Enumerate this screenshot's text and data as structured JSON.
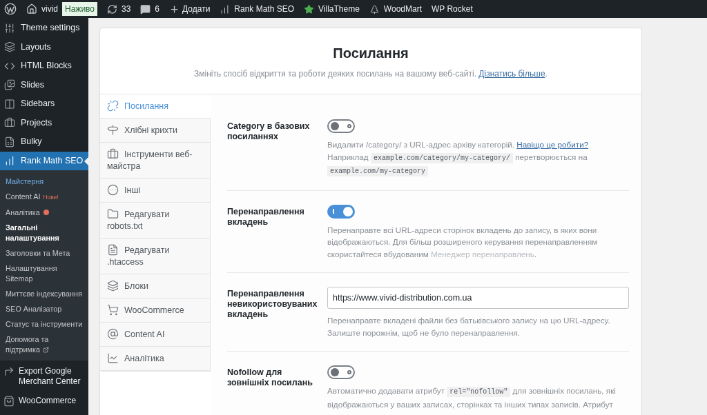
{
  "admin_bar": {
    "site": "vivid",
    "live_badge": "Наживо",
    "updates": "33",
    "comments": "6",
    "new": "Додати",
    "links": [
      "Rank Math SEO",
      "VillaTheme",
      "WoodMart",
      "WP Rocket"
    ]
  },
  "sidebar": {
    "items": [
      {
        "label": "Theme settings",
        "selected": false
      },
      {
        "label": "Layouts",
        "selected": false
      },
      {
        "label": "HTML Blocks",
        "selected": false
      },
      {
        "label": "Slides",
        "selected": false
      },
      {
        "label": "Sidebars",
        "selected": false
      },
      {
        "label": "Projects",
        "selected": false
      },
      {
        "label": "Bulky",
        "selected": false
      },
      {
        "label": "Rank Math SEO",
        "selected": true
      }
    ],
    "submenu": [
      {
        "label": "Майстерня",
        "kind": "plain",
        "selected": false,
        "highlighted": true
      },
      {
        "label": "Content AI",
        "kind": "badge",
        "badge": "Нове!",
        "selected": false,
        "highlighted": false
      },
      {
        "label": "Аналітика",
        "kind": "dot",
        "selected": false,
        "highlighted": false
      },
      {
        "label": "Загальні налаштування",
        "kind": "plain",
        "selected": true,
        "highlighted": false
      },
      {
        "label": "Заголовки та Мета",
        "kind": "plain",
        "selected": false,
        "highlighted": false
      },
      {
        "label": "Налаштування Sitemap",
        "kind": "plain",
        "selected": false,
        "highlighted": false
      },
      {
        "label": "Миттєве індексування",
        "kind": "plain",
        "selected": false,
        "highlighted": false
      },
      {
        "label": "SEO Аналізатор",
        "kind": "plain",
        "selected": false,
        "highlighted": false
      },
      {
        "label": "Статус та інструменти",
        "kind": "plain",
        "selected": false,
        "highlighted": false
      },
      {
        "label": "Допомога та підтримка",
        "kind": "external",
        "selected": false,
        "highlighted": false
      }
    ],
    "after": [
      "Export Google Merchant Center",
      "WooCommerce"
    ]
  },
  "header": {
    "title": "Посилання",
    "subtitle": "Змініть спосіб відкриття та роботи деяких посилань на вашому веб-сайті.",
    "link": "Дізнатись більше",
    "end": "."
  },
  "tabs": [
    {
      "label": "Посилання",
      "selected": true
    },
    {
      "label": "Хлібні крихти",
      "selected": false
    },
    {
      "label": "Інструменти веб-майстра",
      "selected": false
    },
    {
      "label": "Інші",
      "selected": false
    },
    {
      "label": "Редагувати robots.txt",
      "selected": false
    },
    {
      "label": "Редагувати .htaccess",
      "selected": false
    },
    {
      "label": "Блоки",
      "selected": false
    },
    {
      "label": "WooCommerce",
      "selected": false
    },
    {
      "label": "Content AI",
      "selected": false
    },
    {
      "label": "Аналітика",
      "selected": false
    }
  ],
  "settings": [
    {
      "label": "Category в базових посиланнях",
      "kind": "toggle",
      "on": false,
      "description": [
        {
          "kind": "text",
          "text": "Видалити /category/ з URL-адрес архіву категорій. "
        },
        {
          "kind": "link",
          "text": "Навіщо це робити?"
        },
        {
          "kind": "text",
          "text": " Наприклад "
        },
        {
          "kind": "code",
          "text": "example.com/category/my-category/"
        },
        {
          "kind": "text",
          "text": " перетворюється на "
        },
        {
          "kind": "code",
          "text": "example.com/my-category"
        }
      ]
    },
    {
      "label": "Перенаправлення вкладень",
      "kind": "toggle",
      "on": true,
      "description": [
        {
          "kind": "text",
          "text": "Перенаправте всі URL-адреси сторінок вкладень до запису, в яких вони відображаються. Для більш розширеного керування перенаправленням скористайтеся вбудованим "
        },
        {
          "kind": "faint",
          "text": "Менеджер перенаправлень"
        },
        {
          "kind": "text",
          "text": "."
        }
      ]
    },
    {
      "label": "Перенаправлення невикористовуваних вкладень",
      "kind": "input",
      "value": "https://www.vivid-distribution.com.ua",
      "description": [
        {
          "kind": "text",
          "text": "Перенаправте вкладені файли без батьківського запису на цю URL-адресу. Залиште порожнім, щоб не було перенаправлення."
        }
      ]
    },
    {
      "label": "Nofollow для зовнішніх посилань",
      "kind": "toggle",
      "on": false,
      "description": [
        {
          "kind": "text",
          "text": "Автоматично додавати атрибут "
        },
        {
          "kind": "code",
          "text": "rel=\"nofollow\""
        },
        {
          "kind": "text",
          "text": " для зовнішніх посилань, які відображаються у ваших записах, сторінках та інших типах записів. Атрибут"
        }
      ]
    }
  ]
}
